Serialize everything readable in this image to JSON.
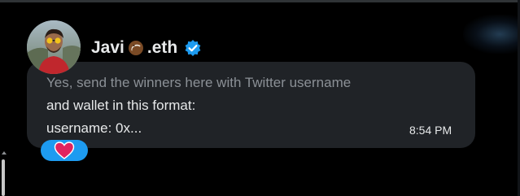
{
  "sender": {
    "name_prefix": "Javi",
    "name_suffix": ".eth",
    "avatar_icon": "avatar-photo",
    "name_emoji_icon": "coconut-icon",
    "verified_icon": "verified-badge-icon"
  },
  "message": {
    "lines": [
      "Yes, send the winners here with Twitter username",
      "and wallet in this format:",
      "username: 0x..."
    ],
    "timestamp": "8:54 PM"
  },
  "reaction": {
    "icon": "red-heart-icon"
  },
  "colors": {
    "background": "#000000",
    "bubble": "#202327",
    "text": "#e7e9ea",
    "faded_text": "#8b9096",
    "verified": "#1d9bf0",
    "reaction_pill": "#1d9bf0",
    "heart": "#e0245e"
  }
}
